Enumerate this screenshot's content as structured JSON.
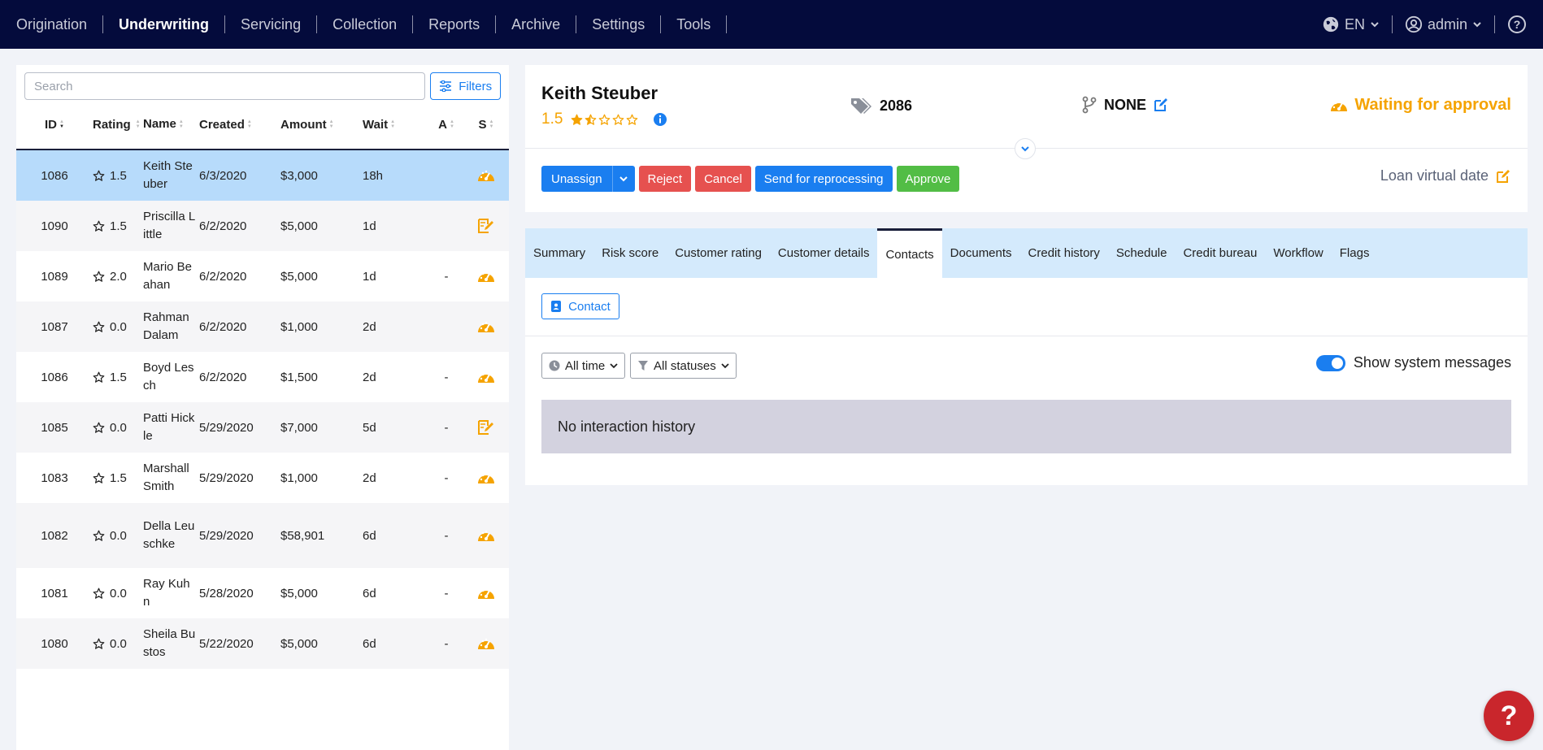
{
  "nav": {
    "items": [
      {
        "label": "Origination",
        "active": false
      },
      {
        "label": "Underwriting",
        "active": true
      },
      {
        "label": "Servicing",
        "active": false
      },
      {
        "label": "Collection",
        "active": false
      },
      {
        "label": "Reports",
        "active": false
      },
      {
        "label": "Archive",
        "active": false
      },
      {
        "label": "Settings",
        "active": false
      },
      {
        "label": "Tools",
        "active": false
      }
    ],
    "language": "EN",
    "user": "admin"
  },
  "list": {
    "search_placeholder": "Search",
    "filters_label": "Filters",
    "columns": [
      "ID",
      "Rating",
      "Name",
      "Created",
      "Amount",
      "Wait",
      "A",
      "S"
    ],
    "rows": [
      {
        "id": "1086",
        "rating": "1.5",
        "name": "Keith Steuber",
        "created": "6/3/2020",
        "amount": "$3,000",
        "wait": "18h",
        "a": "",
        "status": "gauge"
      },
      {
        "id": "1090",
        "rating": "1.5",
        "name": "Priscilla Little",
        "created": "6/2/2020",
        "amount": "$5,000",
        "wait": "1d",
        "a": "",
        "status": "edit"
      },
      {
        "id": "1089",
        "rating": "2.0",
        "name": "Mario Beahan",
        "created": "6/2/2020",
        "amount": "$5,000",
        "wait": "1d",
        "a": "-",
        "status": "gauge"
      },
      {
        "id": "1087",
        "rating": "0.0",
        "name": "Rahman Dalam",
        "created": "6/2/2020",
        "amount": "$1,000",
        "wait": "2d",
        "a": "",
        "status": "gauge"
      },
      {
        "id": "1086",
        "rating": "1.5",
        "name": "Boyd Lesch",
        "created": "6/2/2020",
        "amount": "$1,500",
        "wait": "2d",
        "a": "-",
        "status": "gauge"
      },
      {
        "id": "1085",
        "rating": "0.0",
        "name": "Patti Hickle",
        "created": "5/29/2020",
        "amount": "$7,000",
        "wait": "5d",
        "a": "-",
        "status": "edit"
      },
      {
        "id": "1083",
        "rating": "1.5",
        "name": "Marshall Smith",
        "created": "5/29/2020",
        "amount": "$1,000",
        "wait": "2d",
        "a": "-",
        "status": "gauge"
      },
      {
        "id": "1082",
        "rating": "0.0",
        "name": "Della Leuschke",
        "created": "5/29/2020",
        "amount": "$58,901",
        "wait": "6d",
        "a": "-",
        "status": "gauge"
      },
      {
        "id": "1081",
        "rating": "0.0",
        "name": "Ray Kuhn",
        "created": "5/28/2020",
        "amount": "$5,000",
        "wait": "6d",
        "a": "-",
        "status": "gauge"
      },
      {
        "id": "1080",
        "rating": "0.0",
        "name": "Sheila Bustos",
        "created": "5/22/2020",
        "amount": "$5,000",
        "wait": "6d",
        "a": "-",
        "status": "gauge"
      }
    ]
  },
  "detail": {
    "name": "Keith Steuber",
    "rating": "1.5",
    "stars": 1.5,
    "id": "2086",
    "branch": "NONE",
    "status": "Waiting for approval",
    "loan_virtual_date": "Loan virtual date",
    "actions": {
      "unassign": "Unassign",
      "reject": "Reject",
      "cancel": "Cancel",
      "reprocess": "Send for reprocessing",
      "approve": "Approve"
    }
  },
  "tabs": [
    "Summary",
    "Risk score",
    "Customer rating",
    "Customer details",
    "Contacts",
    "Documents",
    "Credit history",
    "Schedule",
    "Credit bureau",
    "Workflow",
    "Flags"
  ],
  "active_tab": "Contacts",
  "contacts": {
    "contact_button": "Contact",
    "time_filter": "All time",
    "status_filter": "All statuses",
    "toggle_label": "Show system messages",
    "toggle_on": true,
    "empty_text": "No interaction history"
  },
  "colors": {
    "accent": "#1a7ef0",
    "warning": "#f5a300",
    "danger": "#e6514f",
    "success": "#52bd45",
    "topbar": "#040b3c"
  }
}
